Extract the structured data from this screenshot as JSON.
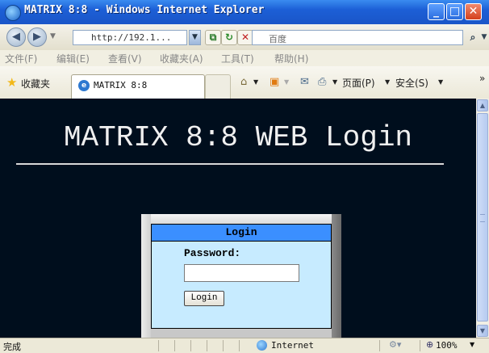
{
  "window": {
    "title": "MATRIX 8:8 - Windows Internet Explorer",
    "minimize": "_",
    "maximize": "□",
    "close": "✕"
  },
  "address_bar": {
    "url": "http://192.1...",
    "search_placeholder": "百度",
    "back_icon": "back-arrow-icon",
    "forward_icon": "forward-arrow-icon",
    "compat_icon": "compatibility-view-icon",
    "refresh_icon": "refresh-icon",
    "stop_icon": "stop-icon"
  },
  "menu": {
    "items": [
      "文件(F)",
      "编辑(E)",
      "查看(V)",
      "收藏夹(A)",
      "工具(T)",
      "帮助(H)"
    ]
  },
  "favorites_bar": {
    "favorites_label": "收藏夹",
    "tab_title": "MATRIX 8:8",
    "page_menu": "页面(P)",
    "safety_menu": "安全(S)",
    "overflow": "»"
  },
  "page": {
    "heading": "MATRIX 8:8 WEB Login",
    "login_title": "Login",
    "password_label": "Password:",
    "password_value": "",
    "login_button": "Login"
  },
  "status_bar": {
    "status": "完成",
    "zone": "Internet",
    "zoom": "100%"
  },
  "colors": {
    "page_background": "#000e1d",
    "login_header": "#3b8fff",
    "login_panel": "#c7ebff"
  }
}
